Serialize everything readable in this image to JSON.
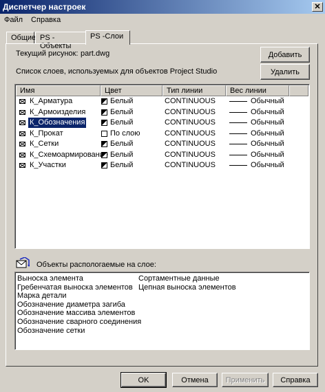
{
  "window": {
    "title": "Диспетчер настроек",
    "close_glyph": "✕"
  },
  "menu": [
    {
      "label": "Файл"
    },
    {
      "label": "Справка"
    }
  ],
  "tabs": [
    {
      "label": "Общие"
    },
    {
      "label": "PS - Объекты"
    },
    {
      "label": "PS -Слои"
    }
  ],
  "drawing": {
    "label": "Текущий рисунок:",
    "value": "part.dwg"
  },
  "layers_caption": "Список слоев, используемых для объектов Project Studio",
  "buttons": {
    "add": "Добавить",
    "delete": "Удалить"
  },
  "columns": [
    "Имя",
    "Цвет",
    "Тип линии",
    "Вес линии"
  ],
  "layers": [
    {
      "name": "К_Арматура",
      "color": "Белый",
      "swatch": "half",
      "linetype": "CONTINUOUS",
      "weight": "Обычный"
    },
    {
      "name": "К_Армоизделия",
      "color": "Белый",
      "swatch": "half",
      "linetype": "CONTINUOUS",
      "weight": "Обычный"
    },
    {
      "name": "К_Обозначения",
      "color": "Белый",
      "swatch": "half",
      "linetype": "CONTINUOUS",
      "weight": "Обычный",
      "selected": true
    },
    {
      "name": "К_Прокат",
      "color": "По слою",
      "swatch": "empty",
      "linetype": "CONTINUOUS",
      "weight": "Обычный"
    },
    {
      "name": "К_Сетки",
      "color": "Белый",
      "swatch": "half",
      "linetype": "CONTINUOUS",
      "weight": "Обычный"
    },
    {
      "name": "К_Схемоармирование",
      "color": "Белый",
      "swatch": "half",
      "linetype": "CONTINUOUS",
      "weight": "Обычный"
    },
    {
      "name": "К_Участки",
      "color": "Белый",
      "swatch": "half",
      "linetype": "CONTINUOUS",
      "weight": "Обычный"
    }
  ],
  "objects_caption": "Объекты распологаемые на слое:",
  "objects_col1": [
    "Выноска элемента",
    "Гребенчатая выноска элементов",
    "Марка детали",
    "Обозначение диаметра загиба",
    "Обозначение массива элементов",
    "Обозначение сварного соединения",
    "Обозначение сетки"
  ],
  "objects_col2": [
    "Сортаментные данные",
    "Цепная выноска элементов"
  ],
  "footer": {
    "ok": "OK",
    "cancel": "Отмена",
    "apply": "Применить",
    "help": "Справка"
  },
  "colors": {
    "selection": "#0a246a",
    "titlebar_start": "#0a246a",
    "titlebar_end": "#a6caf0",
    "face": "#d4d0c8"
  }
}
